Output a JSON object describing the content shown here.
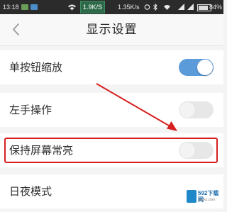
{
  "status_bar": {
    "time": "13:18",
    "network_speed_highlight": "1.9K/S",
    "network_speed_secondary": "1.35K/s",
    "battery_percent": "84%",
    "battery_level": 0.84
  },
  "header": {
    "title": "显示设置",
    "back_icon": "chevron-left-icon"
  },
  "settings": [
    {
      "label": "单按钮缩放",
      "toggle": true
    },
    {
      "label": "左手操作",
      "toggle": false
    },
    {
      "label": "保持屏幕常亮",
      "toggle": false,
      "highlighted": true
    },
    {
      "label": "日夜模式"
    }
  ],
  "annotation": {
    "color": "#d62020"
  },
  "watermark": {
    "text": "592下载网",
    "url": "592xz.com"
  }
}
